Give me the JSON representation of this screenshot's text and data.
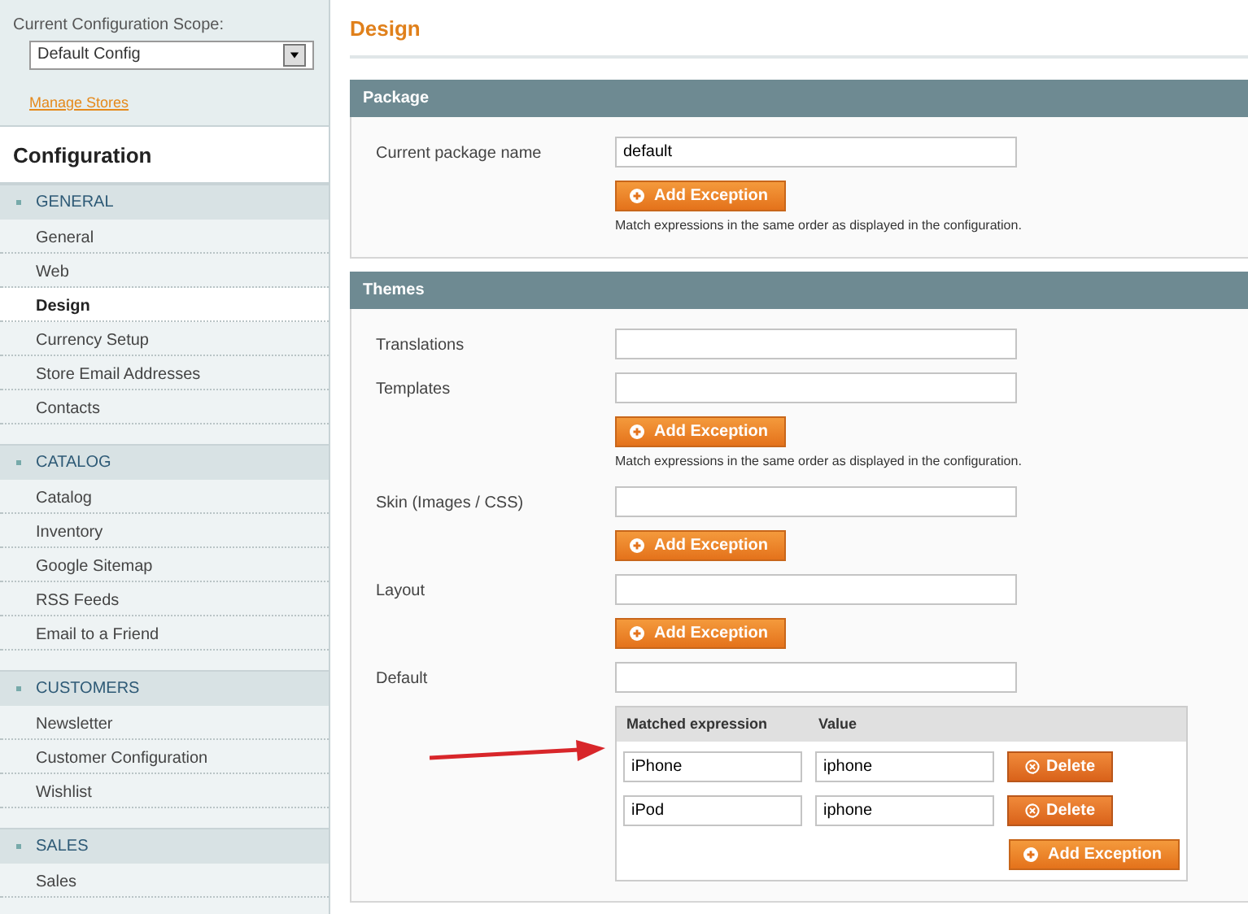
{
  "sidebar": {
    "scope_label": "Current Configuration Scope:",
    "scope_select": "Default Config",
    "manage_link": "Manage Stores",
    "heading": "Configuration",
    "sections": [
      {
        "title": "GENERAL",
        "items": [
          {
            "label": "General",
            "selected": false
          },
          {
            "label": "Web",
            "selected": false
          },
          {
            "label": "Design",
            "selected": true
          },
          {
            "label": "Currency Setup",
            "selected": false
          },
          {
            "label": "Store Email Addresses",
            "selected": false
          },
          {
            "label": "Contacts",
            "selected": false
          }
        ]
      },
      {
        "title": "CATALOG",
        "items": [
          {
            "label": "Catalog",
            "selected": false
          },
          {
            "label": "Inventory",
            "selected": false
          },
          {
            "label": "Google Sitemap",
            "selected": false
          },
          {
            "label": "RSS Feeds",
            "selected": false
          },
          {
            "label": "Email to a Friend",
            "selected": false
          }
        ]
      },
      {
        "title": "CUSTOMERS",
        "items": [
          {
            "label": "Newsletter",
            "selected": false
          },
          {
            "label": "Customer Configuration",
            "selected": false
          },
          {
            "label": "Wishlist",
            "selected": false
          }
        ]
      },
      {
        "title": "SALES",
        "items": [
          {
            "label": "Sales",
            "selected": false
          }
        ]
      }
    ]
  },
  "page_title": "Design",
  "fieldsets": [
    {
      "title": "Package",
      "rows": [
        {
          "label": "Current package name",
          "value": "default",
          "add_button": "Add Exception",
          "note": "Match expressions in the same order as displayed in the configuration."
        }
      ]
    },
    {
      "title": "Themes",
      "rows": [
        {
          "label": "Translations"
        },
        {
          "label": "Templates",
          "add_button": "Add Exception",
          "note": "Match expressions in the same order as displayed in the configuration."
        },
        {
          "label": "Skin (Images / CSS)",
          "add_button": "Add Exception"
        },
        {
          "label": "Layout",
          "add_button": "Add Exception"
        },
        {
          "label": "Default",
          "exceptions": {
            "columns": [
              "Matched expression",
              "Value"
            ],
            "rows": [
              {
                "expression": "iPhone",
                "value": "iphone",
                "delete": "Delete"
              },
              {
                "expression": "iPod",
                "value": "iphone",
                "delete": "Delete"
              }
            ],
            "add_button": "Add Exception"
          }
        }
      ]
    }
  ]
}
